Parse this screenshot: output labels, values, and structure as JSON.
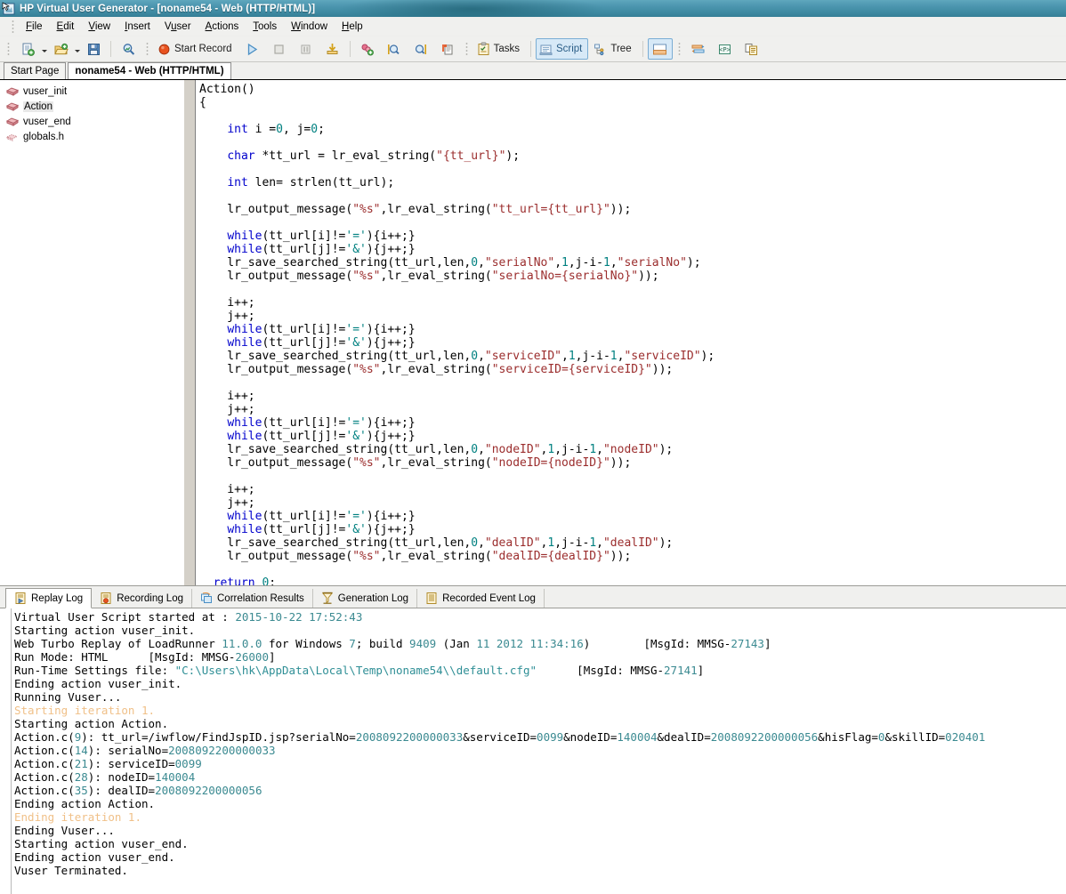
{
  "window": {
    "title": "HP Virtual User Generator - [noname54 - Web (HTTP/HTML)]",
    "icon": "app-icon"
  },
  "menubar": {
    "items": [
      {
        "label": "File",
        "mnemonic": "F"
      },
      {
        "label": "Edit",
        "mnemonic": "E"
      },
      {
        "label": "View",
        "mnemonic": "V"
      },
      {
        "label": "Insert",
        "mnemonic": "I"
      },
      {
        "label": "Vuser",
        "mnemonic": "u"
      },
      {
        "label": "Actions",
        "mnemonic": "A"
      },
      {
        "label": "Tools",
        "mnemonic": "T"
      },
      {
        "label": "Window",
        "mnemonic": "W"
      },
      {
        "label": "Help",
        "mnemonic": "H"
      }
    ]
  },
  "toolbar": {
    "new_script_label": "",
    "open_label": "",
    "save_label": "",
    "zoom_label": "",
    "start_record_label": "Start Record",
    "tasks_label": "Tasks",
    "script_label": "Script",
    "tree_label": "Tree",
    "icons": {
      "new_script": "new-script-icon",
      "open": "open-folder-icon",
      "save": "save-disk-icon",
      "find": "find-icon",
      "record": "record-dot-icon",
      "run": "run-play-icon",
      "stop": "stop-icon",
      "pause": "pause-icon",
      "download": "download-icon",
      "correlate": "correlate-icon",
      "scan_left": "scan-left-icon",
      "scan_right": "scan-right-icon",
      "snapshot": "snapshot-icon",
      "tasks": "tasks-clipboard-icon",
      "script_view": "script-view-icon",
      "tree_view": "tree-view-icon",
      "output_pane": "output-pane-icon",
      "runtime": "runtime-settings-icon",
      "params": "parameter-icon",
      "compare": "compare-icon"
    }
  },
  "doc_tabs": [
    {
      "label": "Start Page",
      "active": false
    },
    {
      "label": "noname54 - Web (HTTP/HTML)",
      "active": true
    }
  ],
  "tree": {
    "nodes": [
      {
        "label": "vuser_init",
        "icon": "action-block-icon",
        "selected": false
      },
      {
        "label": "Action",
        "icon": "action-block-icon",
        "selected": true
      },
      {
        "label": "vuser_end",
        "icon": "action-block-icon",
        "selected": false
      },
      {
        "label": "globals.h",
        "icon": "header-file-icon",
        "selected": false
      }
    ]
  },
  "editor": {
    "lines": [
      [
        {
          "t": "Action()",
          "c": "pln"
        }
      ],
      [
        {
          "t": "{",
          "c": "pln"
        }
      ],
      [],
      [
        {
          "t": "    ",
          "c": "pln"
        },
        {
          "t": "int",
          "c": "kw"
        },
        {
          "t": " i =",
          "c": "pln"
        },
        {
          "t": "0",
          "c": "num"
        },
        {
          "t": ", j=",
          "c": "pln"
        },
        {
          "t": "0",
          "c": "num"
        },
        {
          "t": ";",
          "c": "pln"
        }
      ],
      [],
      [
        {
          "t": "    ",
          "c": "pln"
        },
        {
          "t": "char",
          "c": "kw"
        },
        {
          "t": " *tt_url = lr_eval_string(",
          "c": "pln"
        },
        {
          "t": "\"{tt_url}\"",
          "c": "str"
        },
        {
          "t": ");",
          "c": "pln"
        }
      ],
      [],
      [
        {
          "t": "    ",
          "c": "pln"
        },
        {
          "t": "int",
          "c": "kw"
        },
        {
          "t": " len= strlen(tt_url);",
          "c": "pln"
        }
      ],
      [],
      [
        {
          "t": "    lr_output_message(",
          "c": "pln"
        },
        {
          "t": "\"%s\"",
          "c": "str"
        },
        {
          "t": ",lr_eval_string(",
          "c": "pln"
        },
        {
          "t": "\"tt_url={tt_url}\"",
          "c": "str"
        },
        {
          "t": "));",
          "c": "pln"
        }
      ],
      [],
      [
        {
          "t": "    ",
          "c": "pln"
        },
        {
          "t": "while",
          "c": "kw"
        },
        {
          "t": "(tt_url[i]!=",
          "c": "pln"
        },
        {
          "t": "'='",
          "c": "chr"
        },
        {
          "t": "){i++;}",
          "c": "pln"
        }
      ],
      [
        {
          "t": "    ",
          "c": "pln"
        },
        {
          "t": "while",
          "c": "kw"
        },
        {
          "t": "(tt_url[j]!=",
          "c": "pln"
        },
        {
          "t": "'&'",
          "c": "chr"
        },
        {
          "t": "){j++;}",
          "c": "pln"
        }
      ],
      [
        {
          "t": "    lr_save_searched_string(tt_url,len,",
          "c": "pln"
        },
        {
          "t": "0",
          "c": "num"
        },
        {
          "t": ",",
          "c": "pln"
        },
        {
          "t": "\"serialNo\"",
          "c": "str"
        },
        {
          "t": ",",
          "c": "pln"
        },
        {
          "t": "1",
          "c": "num"
        },
        {
          "t": ",j-i-",
          "c": "pln"
        },
        {
          "t": "1",
          "c": "num"
        },
        {
          "t": ",",
          "c": "pln"
        },
        {
          "t": "\"serialNo\"",
          "c": "str"
        },
        {
          "t": ");",
          "c": "pln"
        }
      ],
      [
        {
          "t": "    lr_output_message(",
          "c": "pln"
        },
        {
          "t": "\"%s\"",
          "c": "str"
        },
        {
          "t": ",lr_eval_string(",
          "c": "pln"
        },
        {
          "t": "\"serialNo={serialNo}\"",
          "c": "str"
        },
        {
          "t": "));",
          "c": "pln"
        }
      ],
      [],
      [
        {
          "t": "    i++;",
          "c": "pln"
        }
      ],
      [
        {
          "t": "    j++;",
          "c": "pln"
        }
      ],
      [
        {
          "t": "    ",
          "c": "pln"
        },
        {
          "t": "while",
          "c": "kw"
        },
        {
          "t": "(tt_url[i]!=",
          "c": "pln"
        },
        {
          "t": "'='",
          "c": "chr"
        },
        {
          "t": "){i++;}",
          "c": "pln"
        }
      ],
      [
        {
          "t": "    ",
          "c": "pln"
        },
        {
          "t": "while",
          "c": "kw"
        },
        {
          "t": "(tt_url[j]!=",
          "c": "pln"
        },
        {
          "t": "'&'",
          "c": "chr"
        },
        {
          "t": "){j++;}",
          "c": "pln"
        }
      ],
      [
        {
          "t": "    lr_save_searched_string(tt_url,len,",
          "c": "pln"
        },
        {
          "t": "0",
          "c": "num"
        },
        {
          "t": ",",
          "c": "pln"
        },
        {
          "t": "\"serviceID\"",
          "c": "str"
        },
        {
          "t": ",",
          "c": "pln"
        },
        {
          "t": "1",
          "c": "num"
        },
        {
          "t": ",j-i-",
          "c": "pln"
        },
        {
          "t": "1",
          "c": "num"
        },
        {
          "t": ",",
          "c": "pln"
        },
        {
          "t": "\"serviceID\"",
          "c": "str"
        },
        {
          "t": ");",
          "c": "pln"
        }
      ],
      [
        {
          "t": "    lr_output_message(",
          "c": "pln"
        },
        {
          "t": "\"%s\"",
          "c": "str"
        },
        {
          "t": ",lr_eval_string(",
          "c": "pln"
        },
        {
          "t": "\"serviceID={serviceID}\"",
          "c": "str"
        },
        {
          "t": "));",
          "c": "pln"
        }
      ],
      [],
      [
        {
          "t": "    i++;",
          "c": "pln"
        }
      ],
      [
        {
          "t": "    j++;",
          "c": "pln"
        }
      ],
      [
        {
          "t": "    ",
          "c": "pln"
        },
        {
          "t": "while",
          "c": "kw"
        },
        {
          "t": "(tt_url[i]!=",
          "c": "pln"
        },
        {
          "t": "'='",
          "c": "chr"
        },
        {
          "t": "){i++;}",
          "c": "pln"
        }
      ],
      [
        {
          "t": "    ",
          "c": "pln"
        },
        {
          "t": "while",
          "c": "kw"
        },
        {
          "t": "(tt_url[j]!=",
          "c": "pln"
        },
        {
          "t": "'&'",
          "c": "chr"
        },
        {
          "t": "){j++;}",
          "c": "pln"
        }
      ],
      [
        {
          "t": "    lr_save_searched_string(tt_url,len,",
          "c": "pln"
        },
        {
          "t": "0",
          "c": "num"
        },
        {
          "t": ",",
          "c": "pln"
        },
        {
          "t": "\"nodeID\"",
          "c": "str"
        },
        {
          "t": ",",
          "c": "pln"
        },
        {
          "t": "1",
          "c": "num"
        },
        {
          "t": ",j-i-",
          "c": "pln"
        },
        {
          "t": "1",
          "c": "num"
        },
        {
          "t": ",",
          "c": "pln"
        },
        {
          "t": "\"nodeID\"",
          "c": "str"
        },
        {
          "t": ");",
          "c": "pln"
        }
      ],
      [
        {
          "t": "    lr_output_message(",
          "c": "pln"
        },
        {
          "t": "\"%s\"",
          "c": "str"
        },
        {
          "t": ",lr_eval_string(",
          "c": "pln"
        },
        {
          "t": "\"nodeID={nodeID}\"",
          "c": "str"
        },
        {
          "t": "));",
          "c": "pln"
        }
      ],
      [],
      [
        {
          "t": "    i++;",
          "c": "pln"
        }
      ],
      [
        {
          "t": "    j++;",
          "c": "pln"
        }
      ],
      [
        {
          "t": "    ",
          "c": "pln"
        },
        {
          "t": "while",
          "c": "kw"
        },
        {
          "t": "(tt_url[i]!=",
          "c": "pln"
        },
        {
          "t": "'='",
          "c": "chr"
        },
        {
          "t": "){i++;}",
          "c": "pln"
        }
      ],
      [
        {
          "t": "    ",
          "c": "pln"
        },
        {
          "t": "while",
          "c": "kw"
        },
        {
          "t": "(tt_url[j]!=",
          "c": "pln"
        },
        {
          "t": "'&'",
          "c": "chr"
        },
        {
          "t": "){j++;}",
          "c": "pln"
        }
      ],
      [
        {
          "t": "    lr_save_searched_string(tt_url,len,",
          "c": "pln"
        },
        {
          "t": "0",
          "c": "num"
        },
        {
          "t": ",",
          "c": "pln"
        },
        {
          "t": "\"dealID\"",
          "c": "str"
        },
        {
          "t": ",",
          "c": "pln"
        },
        {
          "t": "1",
          "c": "num"
        },
        {
          "t": ",j-i-",
          "c": "pln"
        },
        {
          "t": "1",
          "c": "num"
        },
        {
          "t": ",",
          "c": "pln"
        },
        {
          "t": "\"dealID\"",
          "c": "str"
        },
        {
          "t": ");",
          "c": "pln"
        }
      ],
      [
        {
          "t": "    lr_output_message(",
          "c": "pln"
        },
        {
          "t": "\"%s\"",
          "c": "str"
        },
        {
          "t": ",lr_eval_string(",
          "c": "pln"
        },
        {
          "t": "\"dealID={dealID}\"",
          "c": "str"
        },
        {
          "t": "));",
          "c": "pln"
        }
      ],
      [],
      [
        {
          "t": "  ",
          "c": "pln"
        },
        {
          "t": "return",
          "c": "kw"
        },
        {
          "t": " ",
          "c": "pln"
        },
        {
          "t": "0",
          "c": "num"
        },
        {
          "t": ";",
          "c": "pln"
        }
      ]
    ]
  },
  "log_tabs": [
    {
      "label": "Replay Log",
      "icon": "replay-log-icon",
      "active": true
    },
    {
      "label": "Recording Log",
      "icon": "recording-log-icon",
      "active": false
    },
    {
      "label": "Correlation Results",
      "icon": "correlation-results-icon",
      "active": false
    },
    {
      "label": "Generation Log",
      "icon": "generation-log-icon",
      "active": false
    },
    {
      "label": "Recorded Event Log",
      "icon": "recorded-event-log-icon",
      "active": false
    }
  ],
  "log": {
    "lines": [
      [
        {
          "t": "Virtual User Script started at : ",
          "c": "pln"
        },
        {
          "t": "2015-10-22 17:52:43",
          "c": "lnum"
        }
      ],
      [
        {
          "t": "Starting action vuser_init.",
          "c": "pln"
        }
      ],
      [
        {
          "t": "Web Turbo Replay of LoadRunner ",
          "c": "pln"
        },
        {
          "t": "11.0.0",
          "c": "lnum"
        },
        {
          "t": " for Windows ",
          "c": "pln"
        },
        {
          "t": "7",
          "c": "lnum"
        },
        {
          "t": "; build ",
          "c": "pln"
        },
        {
          "t": "9409",
          "c": "lnum"
        },
        {
          "t": " (Jan ",
          "c": "pln"
        },
        {
          "t": "11 2012 11:34:16",
          "c": "lnum"
        },
        {
          "t": ")        [MsgId: MMSG-",
          "c": "pln"
        },
        {
          "t": "27143",
          "c": "lnum"
        },
        {
          "t": "]",
          "c": "pln"
        }
      ],
      [
        {
          "t": "Run Mode: HTML      [MsgId: MMSG-",
          "c": "pln"
        },
        {
          "t": "26000",
          "c": "lnum"
        },
        {
          "t": "]",
          "c": "pln"
        }
      ],
      [
        {
          "t": "Run-Time Settings file: ",
          "c": "pln"
        },
        {
          "t": "\"C:\\Users\\hk\\AppData\\Local\\Temp\\noname54\\\\default.cfg\"",
          "c": "lstr"
        },
        {
          "t": "      [MsgId: MMSG-",
          "c": "pln"
        },
        {
          "t": "27141",
          "c": "lnum"
        },
        {
          "t": "]",
          "c": "pln"
        }
      ],
      [
        {
          "t": "Ending action vuser_init.",
          "c": "pln"
        }
      ],
      [
        {
          "t": "Running Vuser...",
          "c": "pln"
        }
      ],
      [
        {
          "t": "Starting iteration 1.",
          "c": "lorange"
        }
      ],
      [
        {
          "t": "Starting action Action.",
          "c": "pln"
        }
      ],
      [
        {
          "t": "Action.c(",
          "c": "pln"
        },
        {
          "t": "9",
          "c": "lnum"
        },
        {
          "t": "): tt_url=/iwflow/FindJspID.jsp?serialNo=",
          "c": "pln"
        },
        {
          "t": "2008092200000033",
          "c": "lnum"
        },
        {
          "t": "&serviceID=",
          "c": "pln"
        },
        {
          "t": "0099",
          "c": "lnum"
        },
        {
          "t": "&nodeID=",
          "c": "pln"
        },
        {
          "t": "140004",
          "c": "lnum"
        },
        {
          "t": "&dealID=",
          "c": "pln"
        },
        {
          "t": "2008092200000056",
          "c": "lnum"
        },
        {
          "t": "&hisFlag=",
          "c": "pln"
        },
        {
          "t": "0",
          "c": "lnum"
        },
        {
          "t": "&skillID=",
          "c": "pln"
        },
        {
          "t": "020401",
          "c": "lnum"
        }
      ],
      [
        {
          "t": "Action.c(",
          "c": "pln"
        },
        {
          "t": "14",
          "c": "lnum"
        },
        {
          "t": "): serialNo=",
          "c": "pln"
        },
        {
          "t": "2008092200000033",
          "c": "lnum"
        }
      ],
      [
        {
          "t": "Action.c(",
          "c": "pln"
        },
        {
          "t": "21",
          "c": "lnum"
        },
        {
          "t": "): serviceID=",
          "c": "pln"
        },
        {
          "t": "0099",
          "c": "lnum"
        }
      ],
      [
        {
          "t": "Action.c(",
          "c": "pln"
        },
        {
          "t": "28",
          "c": "lnum"
        },
        {
          "t": "): nodeID=",
          "c": "pln"
        },
        {
          "t": "140004",
          "c": "lnum"
        }
      ],
      [
        {
          "t": "Action.c(",
          "c": "pln"
        },
        {
          "t": "35",
          "c": "lnum"
        },
        {
          "t": "): dealID=",
          "c": "pln"
        },
        {
          "t": "2008092200000056",
          "c": "lnum"
        }
      ],
      [
        {
          "t": "Ending action Action.",
          "c": "pln"
        }
      ],
      [
        {
          "t": "Ending iteration 1.",
          "c": "lorange"
        }
      ],
      [
        {
          "t": "Ending Vuser...",
          "c": "pln"
        }
      ],
      [
        {
          "t": "Starting action vuser_end.",
          "c": "pln"
        }
      ],
      [
        {
          "t": "Ending action vuser_end.",
          "c": "pln"
        }
      ],
      [
        {
          "t": "Vuser Terminated.",
          "c": "pln"
        }
      ]
    ]
  },
  "colors": {
    "titlebar": "#4f98b1",
    "keyword": "#0000cc",
    "string": "#9b2d2d",
    "number": "#008080",
    "log_value": "#3b8a91",
    "log_iteration": "#f0c088",
    "chrome": "#f0f0ee"
  }
}
